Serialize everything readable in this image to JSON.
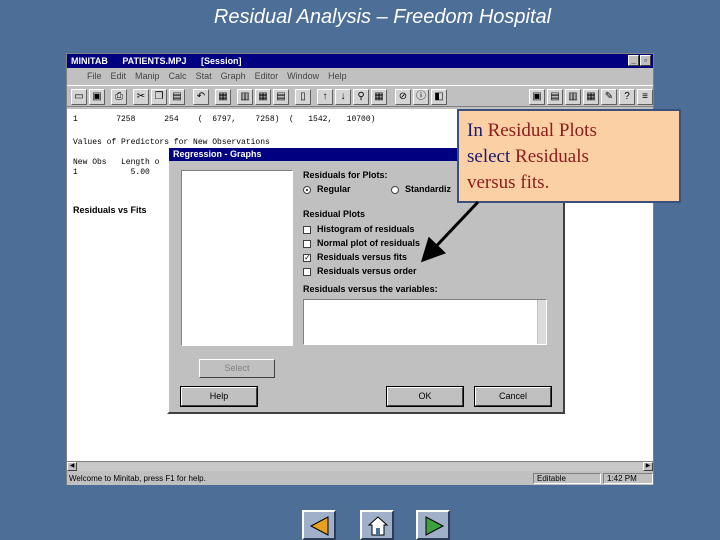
{
  "slide": {
    "title": "Residual Analysis – Freedom Hospital"
  },
  "window": {
    "app": "MINITAB",
    "file": "PATIENTS.MPJ",
    "pane": "[Session]",
    "menu": [
      "File",
      "Edit",
      "Manip",
      "Calc",
      "Stat",
      "Graph",
      "Editor",
      "Window",
      "Help"
    ]
  },
  "session": {
    "line1": "1        7258      254    (  6797,    7258)  (   1542,   10700)",
    "line2": "Values of Predictors for New Observations",
    "line3": "New Obs   Length o",
    "line4": "1           5.00",
    "heading": "Residuals vs Fits"
  },
  "status": {
    "message": "Welcome to Minitab, press F1 for help.",
    "mode": "Editable",
    "time": "1:42 PM"
  },
  "dialog": {
    "title": "Regression - Graphs",
    "residuals_for_plots_label": "Residuals for Plots:",
    "radio_regular": "Regular",
    "radio_standardized": "Standardiz",
    "residual_plots_label": "Residual Plots",
    "chk_histogram": "Histogram of residuals",
    "chk_normal": "Normal plot of residuals",
    "chk_fits": "Residuals versus fits",
    "chk_order": "Residuals versus order",
    "vars_label": "Residuals versus the variables:",
    "select_btn": "Select",
    "help_btn": "Help",
    "ok_btn": "OK",
    "cancel_btn": "Cancel"
  },
  "callout": {
    "t1": "In ",
    "t2": "Residual Plots",
    "t3": "select ",
    "t4": "Residuals",
    "t5": "versus fits."
  },
  "colors": {
    "background": "#4d6e96",
    "callout_fill": "#fbd0a4",
    "titlebar": "#000080"
  }
}
